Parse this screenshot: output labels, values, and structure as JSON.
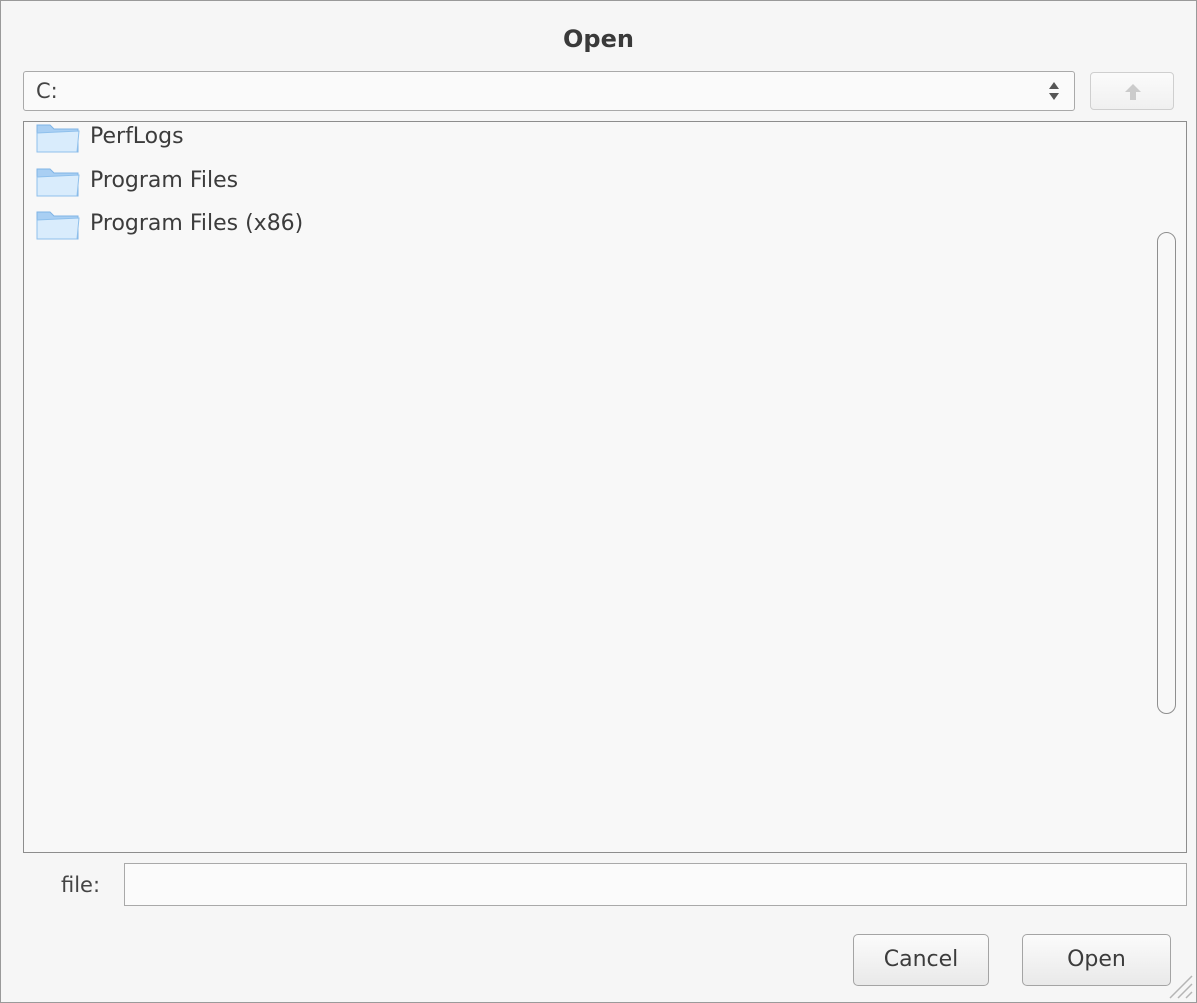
{
  "dialog": {
    "title": "Open"
  },
  "path_bar": {
    "current_path": "C:",
    "up_button_icon": "up-arrow-icon"
  },
  "file_list": {
    "items": [
      {
        "name": "PerfLogs",
        "icon": "folder-icon"
      },
      {
        "name": "Program Files",
        "icon": "folder-icon"
      },
      {
        "name": "Program Files (x86)",
        "icon": "folder-icon"
      }
    ]
  },
  "file_field": {
    "label": "file:",
    "value": ""
  },
  "buttons": {
    "cancel_label": "Cancel",
    "open_label": "Open"
  },
  "colors": {
    "background": "#f6f6f6",
    "border": "#8d8d8d",
    "folder_light": "#cfe6fa",
    "folder_dark": "#7fb4e6"
  }
}
